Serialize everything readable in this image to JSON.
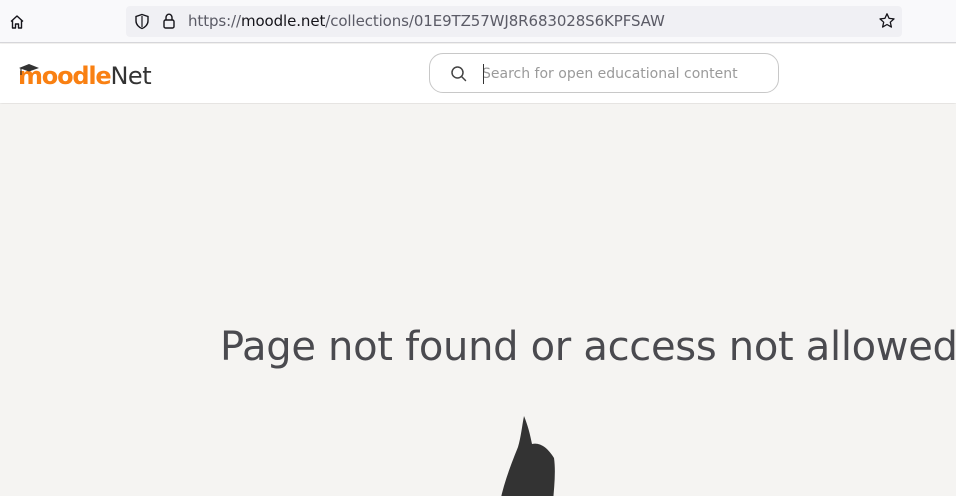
{
  "browser": {
    "url_scheme": "https://",
    "url_domain": "moodle.net",
    "url_path": "/collections/01E9TZ57WJ8R683028S6KPFSAW"
  },
  "header": {
    "logo_part1": "moodle",
    "logo_part2": "Net",
    "search_placeholder": "Search for open educational content"
  },
  "main": {
    "error_title": "Page not found or access not allowed"
  },
  "colors": {
    "brand_orange": "#f98012",
    "page_bg": "#f5f4f2",
    "text_dark": "#4a4a4f"
  },
  "icons": {
    "home": "home-icon",
    "shield": "shield-icon",
    "lock": "lock-icon",
    "star": "star-icon",
    "search": "search-icon",
    "cap": "graduation-cap-icon"
  }
}
